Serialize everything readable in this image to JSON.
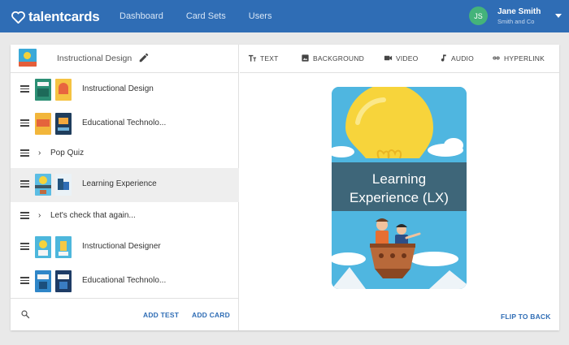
{
  "app": {
    "logo": "talentcards",
    "nav": [
      "Dashboard",
      "Card Sets",
      "Users"
    ],
    "user": {
      "initials": "JS",
      "name": "Jane Smith",
      "org": "Smith and Co"
    }
  },
  "set": {
    "title": "Instructional Design"
  },
  "items": [
    {
      "type": "card",
      "label": "Instructional Design"
    },
    {
      "type": "card",
      "label": "Educational Technolo..."
    },
    {
      "type": "quiz",
      "label": "Pop Quiz"
    },
    {
      "type": "card",
      "label": "Learning Experience",
      "selected": true
    },
    {
      "type": "quiz",
      "label": "Let's check that again..."
    },
    {
      "type": "card",
      "label": "Instructional Designer"
    },
    {
      "type": "card",
      "label": "Educational Technolo..."
    }
  ],
  "footer": {
    "add_test": "ADD TEST",
    "add_card": "ADD CARD"
  },
  "toolbar": [
    "TEXT",
    "BACKGROUND",
    "VIDEO",
    "AUDIO",
    "HYPERLINK"
  ],
  "card": {
    "title_line1": "Learning",
    "title_line2": "Experience (LX)"
  },
  "flip": "FLIP TO BACK",
  "colors": {
    "brand": "#2f6db5",
    "avatar": "#44b37a",
    "selected_row": "#eeeeee",
    "card_sky": "#4fb6e0",
    "bulb": "#f7d43b"
  },
  "icons": [
    "heart-logo-icon",
    "caret-down-icon",
    "pencil-icon",
    "drag-handle-icon",
    "chevron-right-icon",
    "search-icon",
    "text-icon",
    "image-icon",
    "video-icon",
    "music-note-icon",
    "link-icon"
  ]
}
